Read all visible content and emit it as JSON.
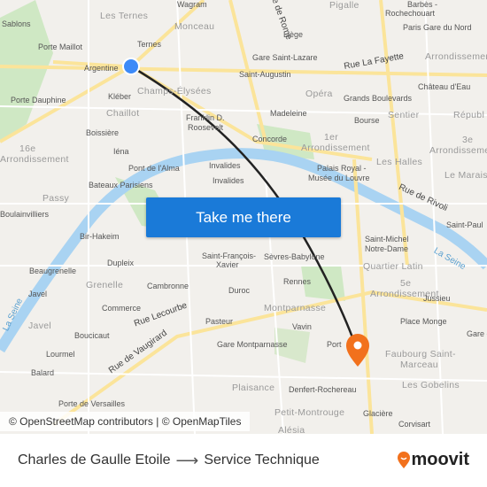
{
  "map": {
    "labels": {
      "les_ternes": "Les Ternes",
      "monceau": "Monceau",
      "pigalle": "Pigalle",
      "barbes": "Barbès -",
      "rochechouart": "Rochechouart",
      "sablons": "Sablons",
      "porte_maillot": "Porte Maillot",
      "ternes": "Ternes",
      "liege": "Liège",
      "gare_nord": "Paris Gare du Nord",
      "argentine": "Argentine",
      "gare_st_lazare": "Gare Saint-Lazare",
      "rue_lafayette": "Rue La Fayette",
      "arr10": "Arrondissement",
      "st_augustin": "Saint-Augustin",
      "porte_dauphine": "Porte Dauphine",
      "kleber": "Kléber",
      "champs": "Champs-Élysées",
      "opera": "Opéra",
      "grands_blvd": "Grands Boulevards",
      "chateau_eau": "Château d'Eau",
      "chaillot": "Chaillot",
      "madeleine": "Madeleine",
      "sentier": "Sentier",
      "republique": "Républ",
      "franklin": "Franklin D.",
      "roosevelt": "Roosevelt",
      "bourse": "Bourse",
      "boissiere": "Boissière",
      "concorde": "Concorde",
      "arr1a": "1er",
      "arr1b": "Arrondissement",
      "arr3a": "3e",
      "arr3b": "Arrondissement",
      "arr16a": "16e",
      "arr16b": "Arrondissement",
      "iena": "Iéna",
      "invalides1": "Invalides",
      "pont_alma": "Pont de l'Alma",
      "palais_royal": "Palais Royal -",
      "louvre": "Musée du Louvre",
      "les_halles": "Les Halles",
      "le_marais": "Le Marais",
      "invalides2": "Invalides",
      "bateaux": "Bateaux Parisiens",
      "passy": "Passy",
      "rue_rivoli": "Rue de Rivoli",
      "boulainvilliers": "Boulainvilliers",
      "st_paul": "Saint-Paul",
      "bir_hakeim": "Bir-Hakeim",
      "st_michel": "Saint-Michel",
      "notre_dame": "Notre-Dame",
      "la_seine1": "La Seine",
      "st_francois": "Saint-François-",
      "xavier": "Xavier",
      "sevres": "Sèvres-Babylone",
      "beaugrenelle": "Beaugrenelle",
      "dupleix": "Dupleix",
      "quartier_latin": "Quartier Latin",
      "grenelle": "Grenelle",
      "cambronne": "Cambronne",
      "arr5a": "5e",
      "arr5b": "Arrondissement",
      "javel1": "Javel",
      "rennes": "Rennes",
      "jussieu": "Jussieu",
      "duroc": "Duroc",
      "commerce": "Commerce",
      "montparnasse": "Montparnasse",
      "rue_lecourbe": "Rue Lecourbe",
      "la_seine2": "La Seine",
      "pasteur": "Pasteur",
      "place_monge": "Place Monge",
      "vavin": "Vavin",
      "javel2": "Javel",
      "boucicaut": "Boucicaut",
      "port": "Port",
      "gare_montparnasse": "Gare Montparnasse",
      "rue_vaugirard": "Rue de Vaugirard",
      "lourmel": "Lourmel",
      "faubourg": "Faubourg Saint-",
      "marceau": "Marceau",
      "balard": "Balard",
      "plaisance": "Plaisance",
      "denfert": "Denfert-Rochereau",
      "gobelins": "Les Gobelins",
      "porte_versailles": "Porte de Versailles",
      "wagram": "Wagram",
      "rome": "Rue de Rome",
      "gare_e": "Gare e",
      "glaciere": "Glacière",
      "petit_montrouge": "Petit-Montrouge",
      "alesia": "Alésia",
      "corvisart": "Corvisart"
    },
    "origin_color": "#3d8af7",
    "destination_color": "#f2711c",
    "route_color": "#222222"
  },
  "cta_label": "Take me there",
  "attribution": "© OpenStreetMap contributors | © OpenMapTiles",
  "footer": {
    "origin": "Charles de Gaulle Etoile",
    "arrow": "⟶",
    "destination": "Service Technique"
  },
  "logo": {
    "text": "moovit",
    "color": "#f2711c"
  }
}
